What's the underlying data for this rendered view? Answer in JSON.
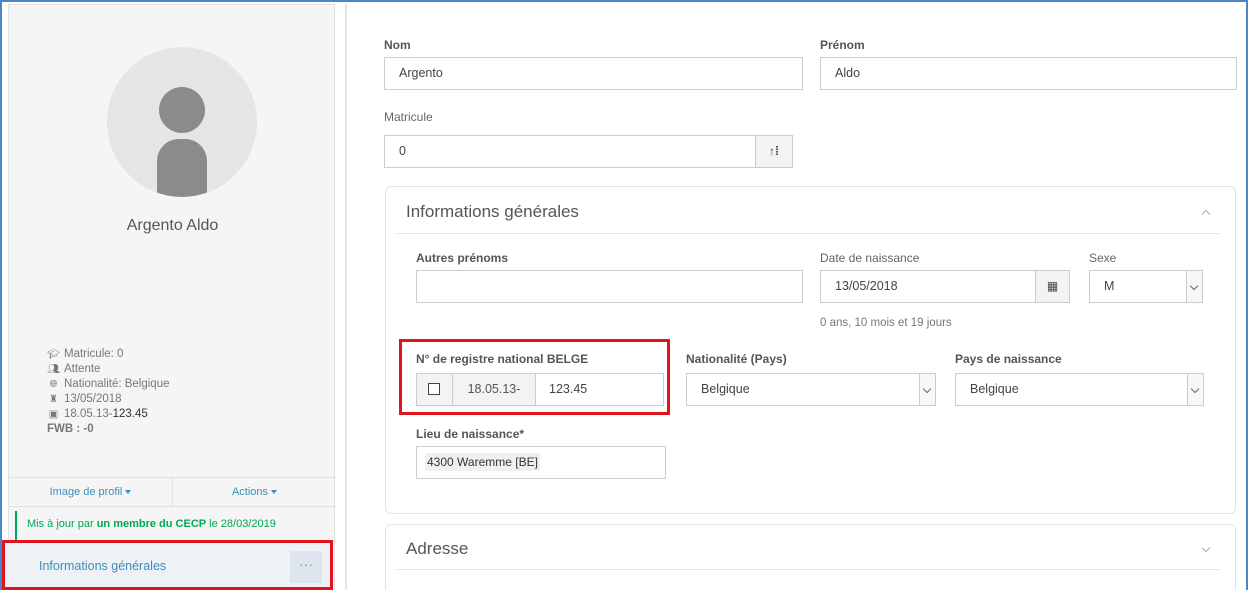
{
  "profile": {
    "name": "Argento Aldo",
    "meta": {
      "matricule": "Matricule: 0",
      "status": "Attente",
      "nationality": "Nationalité: Belgique",
      "birthdate": "13/05/2018",
      "registry_prefix": "18.05.13-",
      "registry_suffix": "123.45",
      "fwb": "FWB : -0"
    },
    "image_button": "Image de profil",
    "actions_button": "Actions",
    "update_note_prefix": "Mis à jour par ",
    "update_note_author": "un membre du CECP",
    "update_note_suffix": " le 28/03/2019"
  },
  "nav": {
    "active_item": "Informations générales",
    "more": "···"
  },
  "form": {
    "nom_label": "Nom",
    "nom_value": "Argento",
    "prenom_label": "Prénom",
    "prenom_value": "Aldo",
    "matricule_label": "Matricule",
    "matricule_value": "0",
    "general": {
      "title": "Informations générales",
      "autres_prenoms_label": "Autres prénoms",
      "autres_prenoms_value": "",
      "date_naissance_label": "Date de naissance",
      "date_naissance_value": "13/05/2018",
      "age_hint": "0 ans, 10 mois et 19 jours",
      "sexe_label": "Sexe",
      "sexe_value": "M",
      "registre_label": "N° de registre national BELGE",
      "registre_prefix": "18.05.13-",
      "registre_value": "123.45",
      "nationalite_label": "Nationalité (Pays)",
      "nationalite_value": "Belgique",
      "pays_naissance_label": "Pays de naissance",
      "pays_naissance_value": "Belgique",
      "lieu_naissance_label": "Lieu de naissance*",
      "lieu_naissance_value": "4300 Waremme [BE]"
    },
    "adresse": {
      "title": "Adresse"
    }
  },
  "colors": {
    "accent": "#3c8dbc",
    "success": "#00a65a",
    "highlight": "#e0141e"
  }
}
